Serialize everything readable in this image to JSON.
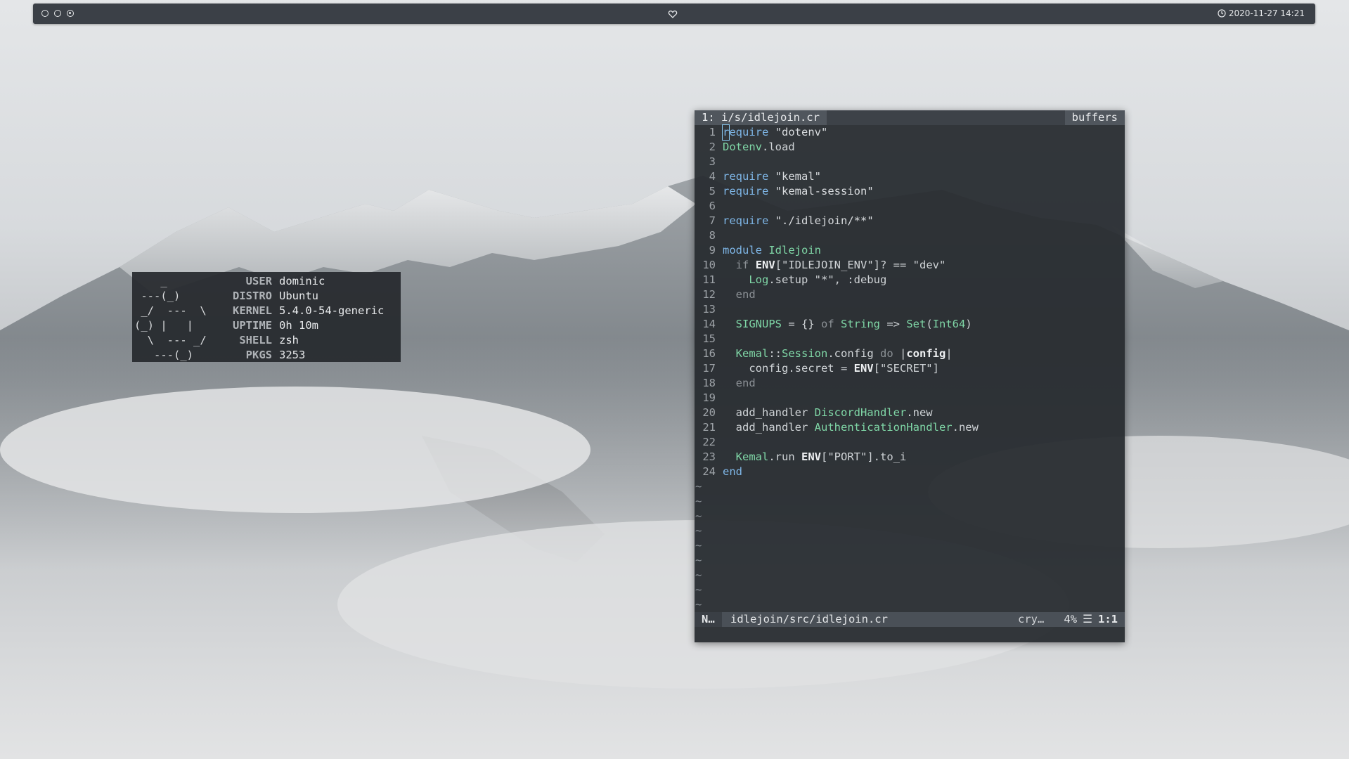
{
  "panel": {
    "workspaces": [
      "workspace-1",
      "workspace-2",
      "workspace-3"
    ],
    "active_workspace": 3,
    "center_icon": "heart-icon",
    "clock_icon": "clock-icon",
    "datetime": "2020-11-27 14:21"
  },
  "neofetch": {
    "logo": "    _\n ---(_)\n _/  ---  \\\n(_) |   |\n  \\  --- _/\n   ---(_)",
    "rows": [
      {
        "key": "USER",
        "value": "dominic"
      },
      {
        "key": "DISTRO",
        "value": "Ubuntu"
      },
      {
        "key": "KERNEL",
        "value": "5.4.0-54-generic"
      },
      {
        "key": "UPTIME",
        "value": "0h 10m"
      },
      {
        "key": "SHELL",
        "value": "zsh"
      },
      {
        "key": "PKGS",
        "value": "3253"
      }
    ]
  },
  "editor": {
    "tab_label": "1: i/s/idlejoin.cr",
    "buffers_label": "buffers",
    "lines": [
      {
        "n": "1",
        "tokens": [
          [
            "kw",
            "require"
          ],
          [
            "sym",
            " "
          ],
          [
            "str",
            "\"dotenv\""
          ]
        ]
      },
      {
        "n": "2",
        "tokens": [
          [
            "cst",
            "Dotenv"
          ],
          [
            "sym",
            ".load"
          ]
        ]
      },
      {
        "n": "3",
        "tokens": []
      },
      {
        "n": "4",
        "tokens": [
          [
            "kw",
            "require"
          ],
          [
            "sym",
            " "
          ],
          [
            "str",
            "\"kemal\""
          ]
        ]
      },
      {
        "n": "5",
        "tokens": [
          [
            "kw",
            "require"
          ],
          [
            "sym",
            " "
          ],
          [
            "str",
            "\"kemal-session\""
          ]
        ]
      },
      {
        "n": "6",
        "tokens": []
      },
      {
        "n": "7",
        "tokens": [
          [
            "kw",
            "require"
          ],
          [
            "sym",
            " "
          ],
          [
            "str",
            "\"./idlejoin/**\""
          ]
        ]
      },
      {
        "n": "8",
        "tokens": []
      },
      {
        "n": "9",
        "tokens": [
          [
            "kw",
            "module"
          ],
          [
            "sym",
            " "
          ],
          [
            "cst",
            "Idlejoin"
          ]
        ]
      },
      {
        "n": "10",
        "tokens": [
          [
            "sym",
            "  "
          ],
          [
            "mut",
            "if"
          ],
          [
            "sym",
            " "
          ],
          [
            "bold",
            "ENV"
          ],
          [
            "sym",
            "[\"IDLEJOIN_ENV\"]? == \"dev\""
          ]
        ]
      },
      {
        "n": "11",
        "tokens": [
          [
            "sym",
            "    "
          ],
          [
            "cst",
            "Log"
          ],
          [
            "sym",
            ".setup \"*\", :debug"
          ]
        ]
      },
      {
        "n": "12",
        "tokens": [
          [
            "sym",
            "  "
          ],
          [
            "mut",
            "end"
          ]
        ]
      },
      {
        "n": "13",
        "tokens": []
      },
      {
        "n": "14",
        "tokens": [
          [
            "sym",
            "  "
          ],
          [
            "cst",
            "SIGNUPS"
          ],
          [
            "sym",
            " = {} "
          ],
          [
            "mut",
            "of"
          ],
          [
            "sym",
            " "
          ],
          [
            "cst",
            "String"
          ],
          [
            "sym",
            " => "
          ],
          [
            "cst",
            "Set"
          ],
          [
            "sym",
            "("
          ],
          [
            "cst",
            "Int64"
          ],
          [
            "sym",
            ")"
          ]
        ]
      },
      {
        "n": "15",
        "tokens": []
      },
      {
        "n": "16",
        "tokens": [
          [
            "sym",
            "  "
          ],
          [
            "cst",
            "Kemal"
          ],
          [
            "sym",
            "::"
          ],
          [
            "cst",
            "Session"
          ],
          [
            "sym",
            ".config "
          ],
          [
            "mut",
            "do"
          ],
          [
            "sym",
            " |"
          ],
          [
            "bold",
            "config"
          ],
          [
            "sym",
            "|"
          ]
        ]
      },
      {
        "n": "17",
        "tokens": [
          [
            "sym",
            "    config.secret = "
          ],
          [
            "bold",
            "ENV"
          ],
          [
            "sym",
            "[\"SECRET\"]"
          ]
        ]
      },
      {
        "n": "18",
        "tokens": [
          [
            "sym",
            "  "
          ],
          [
            "mut",
            "end"
          ]
        ]
      },
      {
        "n": "19",
        "tokens": []
      },
      {
        "n": "20",
        "tokens": [
          [
            "sym",
            "  add_handler "
          ],
          [
            "cst",
            "DiscordHandler"
          ],
          [
            "sym",
            ".new"
          ]
        ]
      },
      {
        "n": "21",
        "tokens": [
          [
            "sym",
            "  add_handler "
          ],
          [
            "cst",
            "AuthenticationHandler"
          ],
          [
            "sym",
            ".new"
          ]
        ]
      },
      {
        "n": "22",
        "tokens": []
      },
      {
        "n": "23",
        "tokens": [
          [
            "sym",
            "  "
          ],
          [
            "cst",
            "Kemal"
          ],
          [
            "sym",
            ".run "
          ],
          [
            "bold",
            "ENV"
          ],
          [
            "sym",
            "[\"PORT\"].to_i"
          ]
        ]
      },
      {
        "n": "24",
        "tokens": [
          [
            "kw",
            "end"
          ]
        ]
      }
    ],
    "tilde_char": "~",
    "tilde_count": 9,
    "status": {
      "mode": "N…",
      "file": "idlejoin/src/idlejoin.cr",
      "filetype": "cry…",
      "percent": "4%",
      "line_icon": "☰",
      "position": "1:1"
    }
  }
}
